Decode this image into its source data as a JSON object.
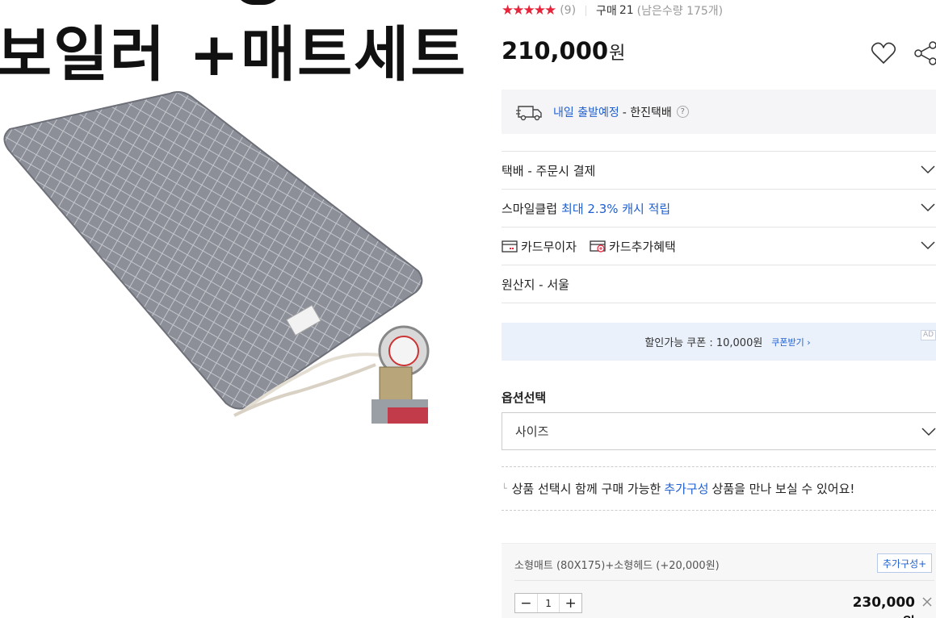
{
  "image": {
    "title_text": "보일러 +매트세트"
  },
  "rating": {
    "stars": "★★★★★",
    "review_count": "(9)",
    "buy_label": "구매",
    "buy_count": "21",
    "stock_text": "(남은수량 175개)"
  },
  "price": {
    "amount": "210,000",
    "unit": "원"
  },
  "delivery": {
    "link_text": "내일 출발예정",
    "rest_text": "- 한진택배",
    "help": "?"
  },
  "info_rows": {
    "shipping": "택배 - 주문시 결제",
    "smile_club_prefix": "스마일클럽",
    "smile_club_benefit": "최대 2.3% 캐시 적립",
    "card_no_interest": "카드무이자",
    "card_extra": "카드추가혜택",
    "origin": "원산지 - 서울"
  },
  "coupon": {
    "text": "할인가능 쿠폰 : 10,000원",
    "link": "쿠폰받기 ›",
    "ad": "AD"
  },
  "options": {
    "title": "옵션선택",
    "select_value": "사이즈"
  },
  "addon_hint": {
    "tick": "└",
    "before": "상품 선택시 함께 구매 가능한",
    "highlight": "추가구성",
    "after": "상품을 만나 보실 수 있어요!"
  },
  "selected_item": {
    "name": "소형매트 (80X175)+소형헤드 (+20,000원)",
    "addon_button": "추가구성+",
    "minus": "−",
    "quantity": "1",
    "plus": "+",
    "price": "230,000",
    "price_unit": "원"
  },
  "colors": {
    "accent_blue": "#1f5fd1",
    "star_red": "#e8243b",
    "coupon_bg": "#eaf1fb"
  }
}
